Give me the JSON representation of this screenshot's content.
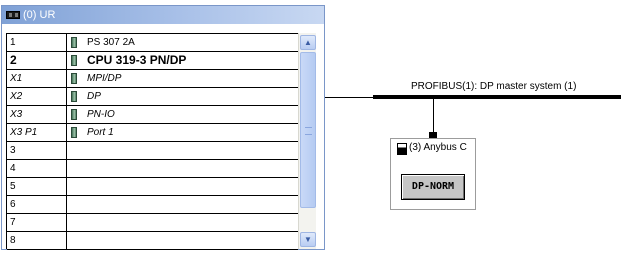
{
  "rack": {
    "title": "(0) UR",
    "rows": [
      {
        "slot": "1",
        "name": "PS 307 2A",
        "style": "normal",
        "icon": true
      },
      {
        "slot": "2",
        "name": "CPU 319-3 PN/DP",
        "style": "bold",
        "icon": true
      },
      {
        "slot": "X1",
        "name": "MPI/DP",
        "style": "italic",
        "icon": true
      },
      {
        "slot": "X2",
        "name": "DP",
        "style": "italic",
        "icon": true
      },
      {
        "slot": "X3",
        "name": "PN-IO",
        "style": "italic",
        "icon": true
      },
      {
        "slot": "X3 P1",
        "name": "Port 1",
        "style": "italic",
        "icon": true
      },
      {
        "slot": "3",
        "name": "",
        "style": "normal",
        "icon": false
      },
      {
        "slot": "4",
        "name": "",
        "style": "normal",
        "icon": false
      },
      {
        "slot": "5",
        "name": "",
        "style": "normal",
        "icon": false
      },
      {
        "slot": "6",
        "name": "",
        "style": "normal",
        "icon": false
      },
      {
        "slot": "7",
        "name": "",
        "style": "normal",
        "icon": false
      },
      {
        "slot": "8",
        "name": "",
        "style": "normal",
        "icon": false
      }
    ],
    "scroll_up_icon": "▲",
    "scroll_down_icon": "▼"
  },
  "network": {
    "bus_label": "PROFIBUS(1): DP master system (1)",
    "station_label": "(3) Anybus C",
    "station_module_label": "DP-NORM"
  },
  "colors": {
    "title_gradient_start": "#7fa1d6",
    "title_gradient_end": "#c8d8f2",
    "module_icon": "#5e8f72",
    "module_button": "#c6c6c6"
  }
}
